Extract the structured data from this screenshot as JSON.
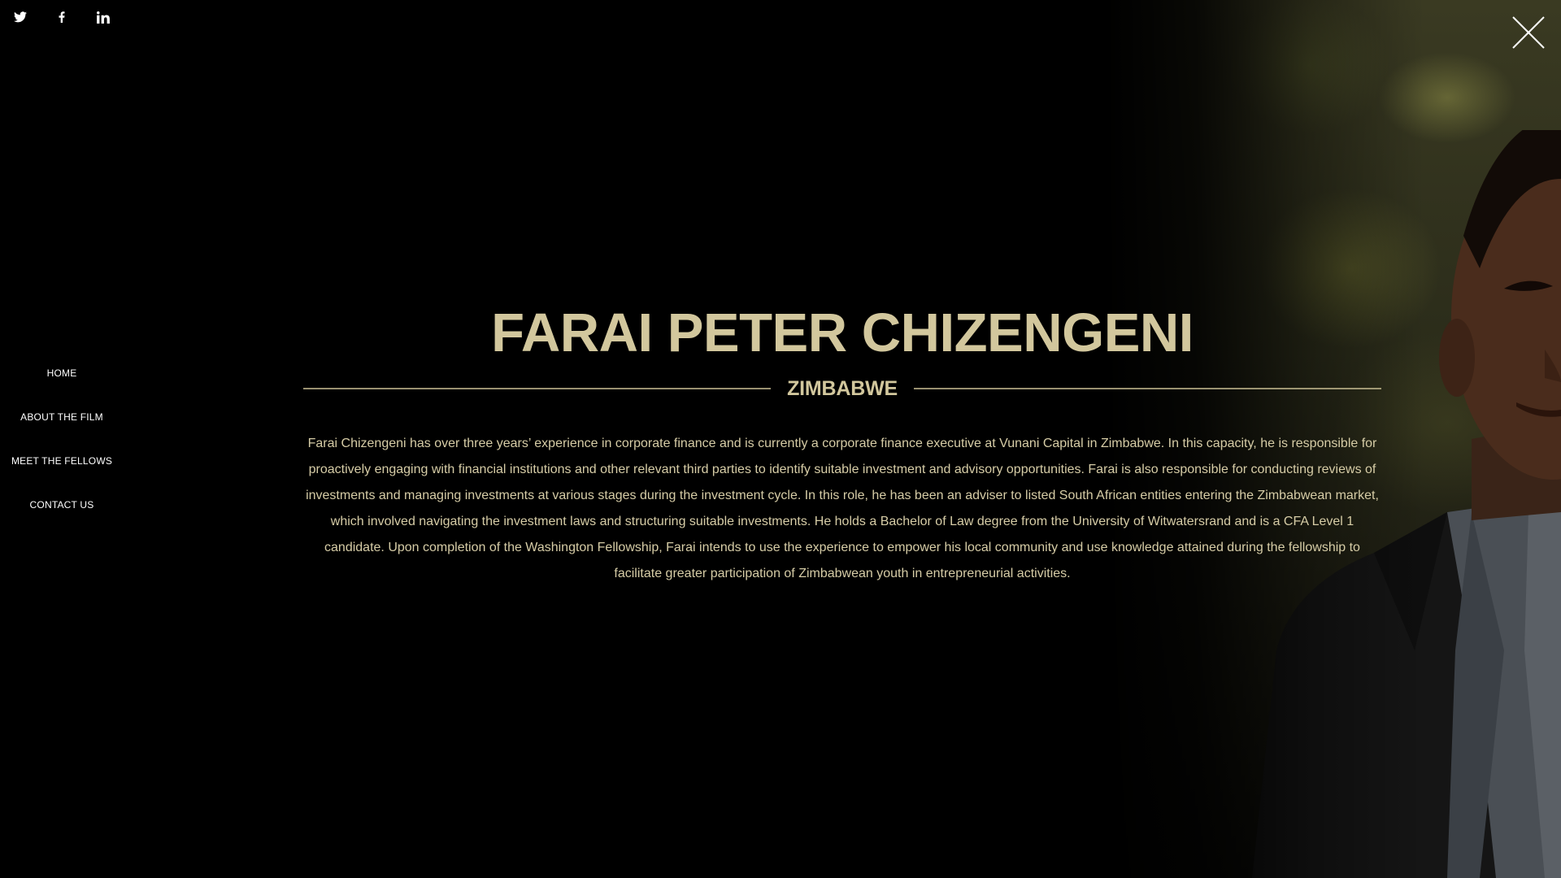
{
  "social": {
    "twitter_icon": "twitter-icon",
    "facebook_icon": "facebook-icon",
    "linkedin_icon": "linkedin-icon"
  },
  "close_icon": "close-icon",
  "nav": {
    "items": [
      {
        "label": "HOME"
      },
      {
        "label": "ABOUT THE FILM"
      },
      {
        "label": "MEET THE FELLOWS"
      },
      {
        "label": "CONTACT US"
      }
    ]
  },
  "profile": {
    "name": "FARAI PETER CHIZENGENI",
    "country": "ZIMBABWE",
    "bio": "Farai Chizengeni has over three years’ experience in corporate finance and is currently a corporate finance executive at Vunani Capital in Zimbabwe. In this capacity, he is responsible for proactively engaging with financial institutions and other relevant third parties to identify suitable investment and advisory opportunities. Farai is also responsible for conducting reviews of investments and managing investments at various stages during the investment cycle. In this role, he has been an adviser to listed South African entities entering the Zimbabwean market, which involved navigating the investment laws and structuring suitable investments. He holds a Bachelor of Law degree from the University of Witwatersrand and is a CFA Level 1 candidate. Upon completion of the Washington Fellowship, Farai intends to use the experience to empower his local community and use knowledge attained during the fellowship to facilitate greater participation of Zimbabwean youth in entrepreneurial activities."
  },
  "colors": {
    "accent": "#d2c79d",
    "background": "#000000",
    "nav_text": "#ffffff"
  }
}
